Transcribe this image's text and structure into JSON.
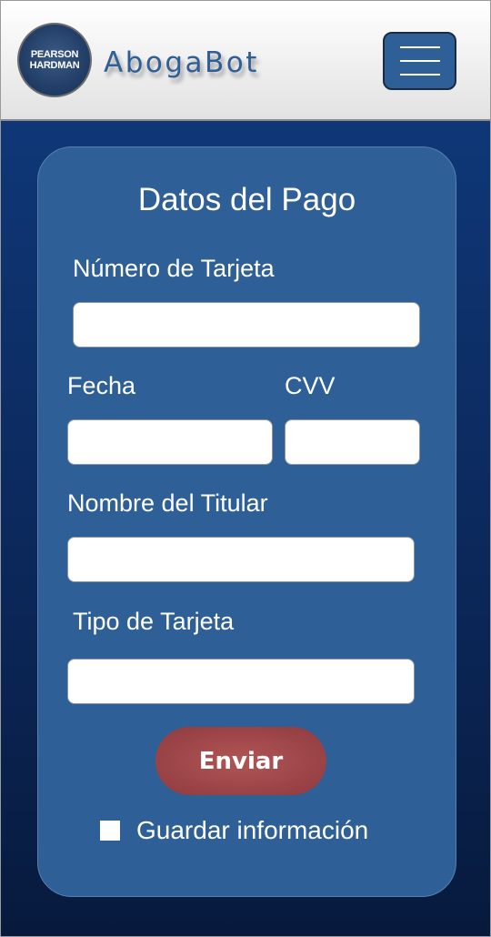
{
  "header": {
    "logo_line1": "PEARSON",
    "logo_line2": "HARDMAN",
    "brand": "AbogaBot",
    "menu_icon": "hamburger-menu-icon"
  },
  "form": {
    "title": "Datos del Pago",
    "card_number_label": "Número de Tarjeta",
    "card_number_value": "",
    "date_label": "Fecha",
    "date_value": "",
    "cvv_label": "CVV",
    "cvv_value": "",
    "holder_label": "Nombre del Titular",
    "holder_value": "",
    "card_type_label": "Tipo de Tarjeta",
    "card_type_value": "",
    "submit_label": "Enviar",
    "save_info_label": "Guardar información",
    "save_info_checked": false
  },
  "colors": {
    "primary": "#2e5f97",
    "background_dark": "#0b2657",
    "submit": "#9b4548"
  }
}
